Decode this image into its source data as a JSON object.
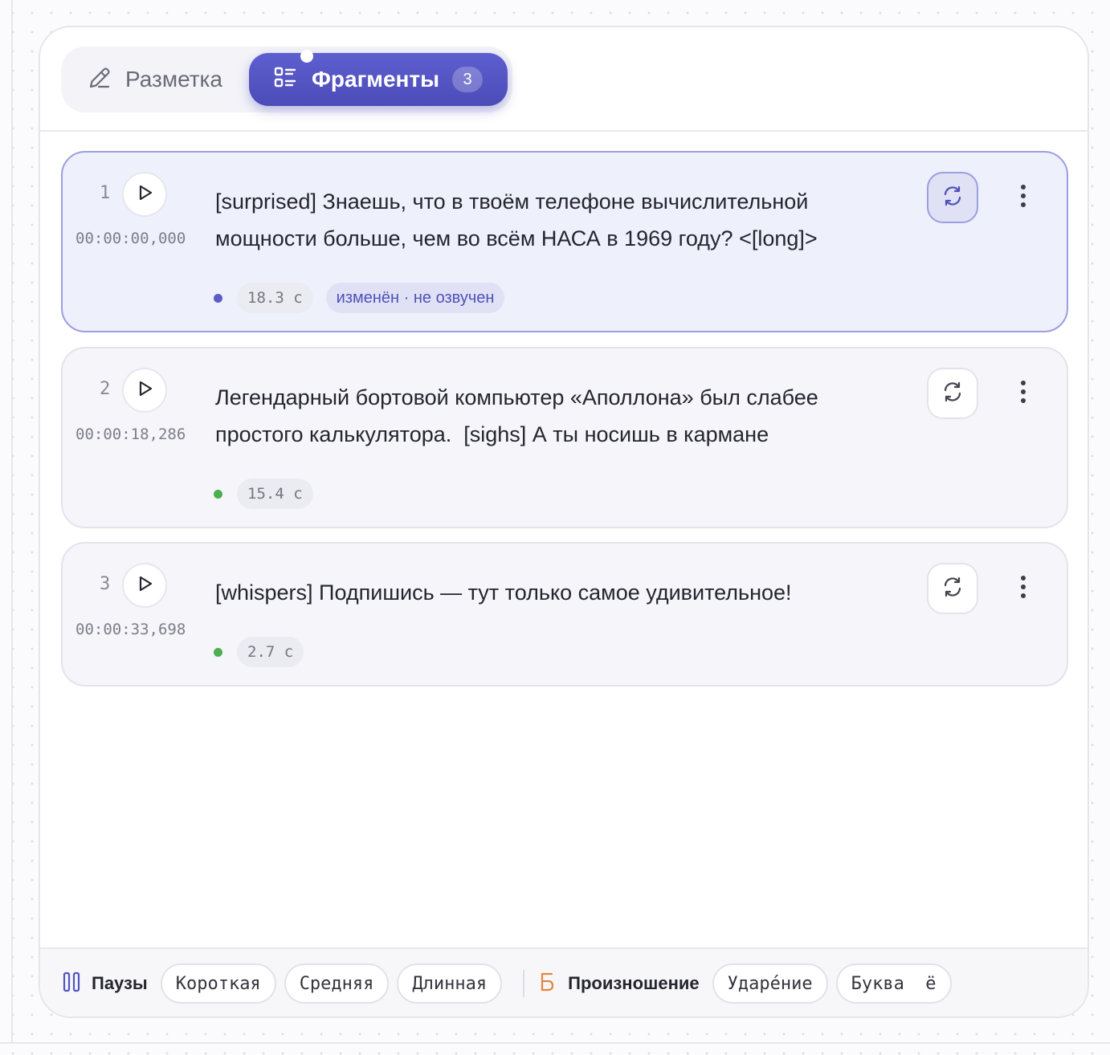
{
  "tabs": {
    "markup": {
      "label": "Разметка",
      "icon": "pencil-icon"
    },
    "fragments": {
      "label": "Фрагменты",
      "icon": "list-icon",
      "count": "3",
      "active": true
    }
  },
  "fragments": [
    {
      "number": "1",
      "timecode": "00:00:00,000",
      "line1": "[surprised] Знаешь, что в твоём телефоне вычислительной",
      "line2": "мощности больше, чем во всём НАСА в 1969 году? <[long]>",
      "duration": "18.3 с",
      "status_label": "изменён · не озвучен",
      "status_color": "#5b5cc8",
      "selected": true
    },
    {
      "number": "2",
      "timecode": "00:00:18,286",
      "line1": "Легендарный бортовой компьютер «Аполлона» был слабее",
      "line2": "простого калькулятора.  [sighs] А ты носишь в кармане",
      "duration": "15.4 с",
      "status_color": "#4caf50",
      "selected": false
    },
    {
      "number": "3",
      "timecode": "00:00:33,698",
      "line1": "[whispers] Подпишись — тут только самое удивительное!",
      "line2": "",
      "duration": "2.7 с",
      "status_color": "#4caf50",
      "selected": false
    }
  ],
  "bottom_bar": {
    "pauses": {
      "title": "Паузы",
      "icon": "pause-icon",
      "options": [
        "Короткая",
        "Средняя",
        "Длинная"
      ]
    },
    "pronunciation": {
      "title": "Произношение",
      "icon": "letter-b-icon",
      "options": [
        "Ударе́ние",
        "Буква  ё"
      ]
    }
  },
  "colors": {
    "accent": "#5354c2",
    "accent_light": "#e0e1f5",
    "success": "#4caf50",
    "icon_orange": "#e3863a"
  }
}
